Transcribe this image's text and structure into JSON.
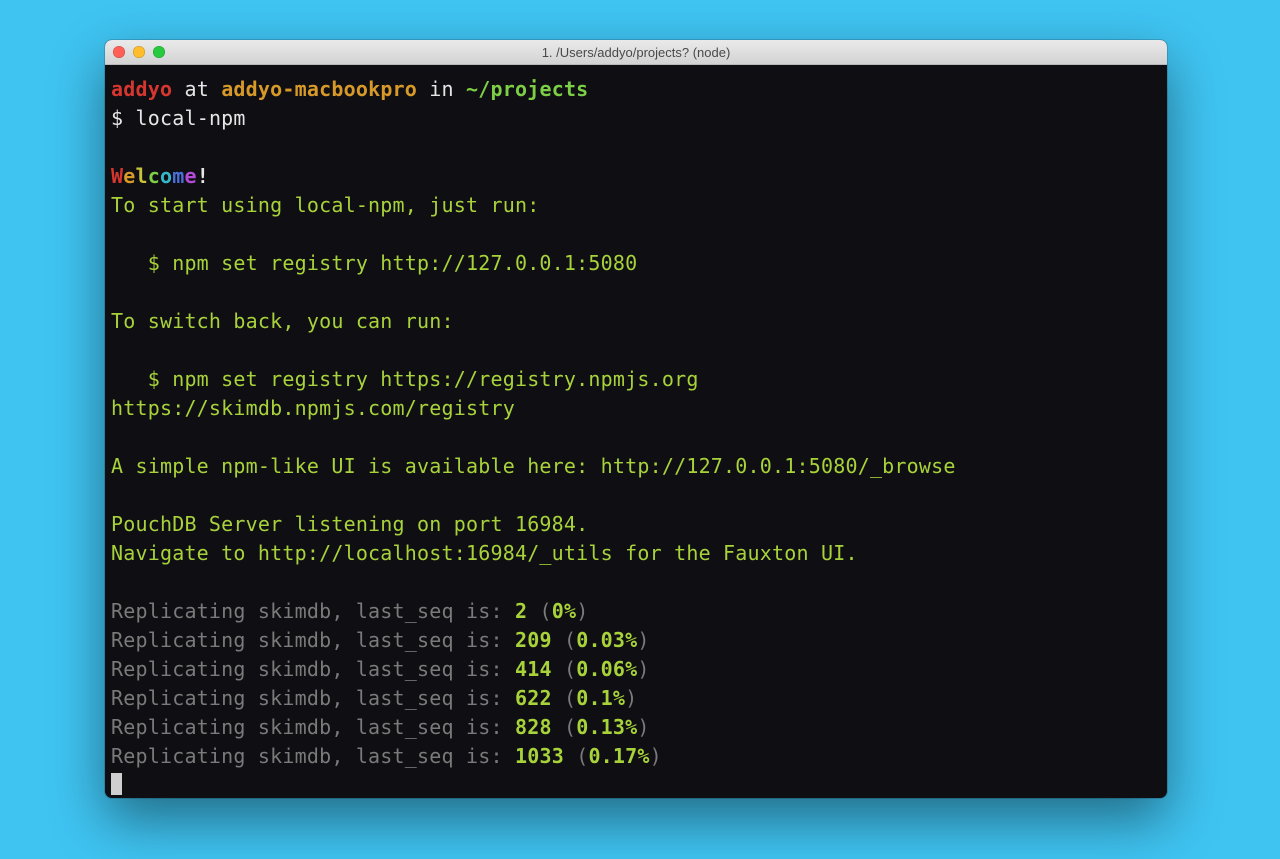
{
  "titlebar": {
    "title": "1. /Users/addyo/projects? (node)"
  },
  "prompt": {
    "user": "addyo",
    "at": " at ",
    "host": "addyo-macbookpro",
    "in": " in ",
    "path": "~/projects",
    "dollar": "$",
    "command": "local-npm"
  },
  "welcome": {
    "letters": [
      "W",
      "e",
      "l",
      "c",
      "o",
      "m",
      "e",
      "!"
    ]
  },
  "lines": {
    "start_hint": "To start using local-npm, just run:",
    "set_local": "   $ npm set registry http://127.0.0.1:5080",
    "switch_hint": "To switch back, you can run:",
    "set_remote": "   $ npm set registry https://registry.npmjs.org",
    "skimdb_url": "https://skimdb.npmjs.com/registry",
    "ui_hint": "A simple npm-like UI is available here: http://127.0.0.1:5080/_browse",
    "pouch": "PouchDB Server listening on port 16984.",
    "fauxton": "Navigate to http://localhost:16984/_utils for the Fauxton UI."
  },
  "replication": {
    "prefix": "Replicating skimdb, last_seq is: ",
    "rows": [
      {
        "seq": "2",
        "pct": "0%"
      },
      {
        "seq": "209",
        "pct": "0.03%"
      },
      {
        "seq": "414",
        "pct": "0.06%"
      },
      {
        "seq": "622",
        "pct": "0.1%"
      },
      {
        "seq": "828",
        "pct": "0.13%"
      },
      {
        "seq": "1033",
        "pct": "0.17%"
      }
    ]
  }
}
